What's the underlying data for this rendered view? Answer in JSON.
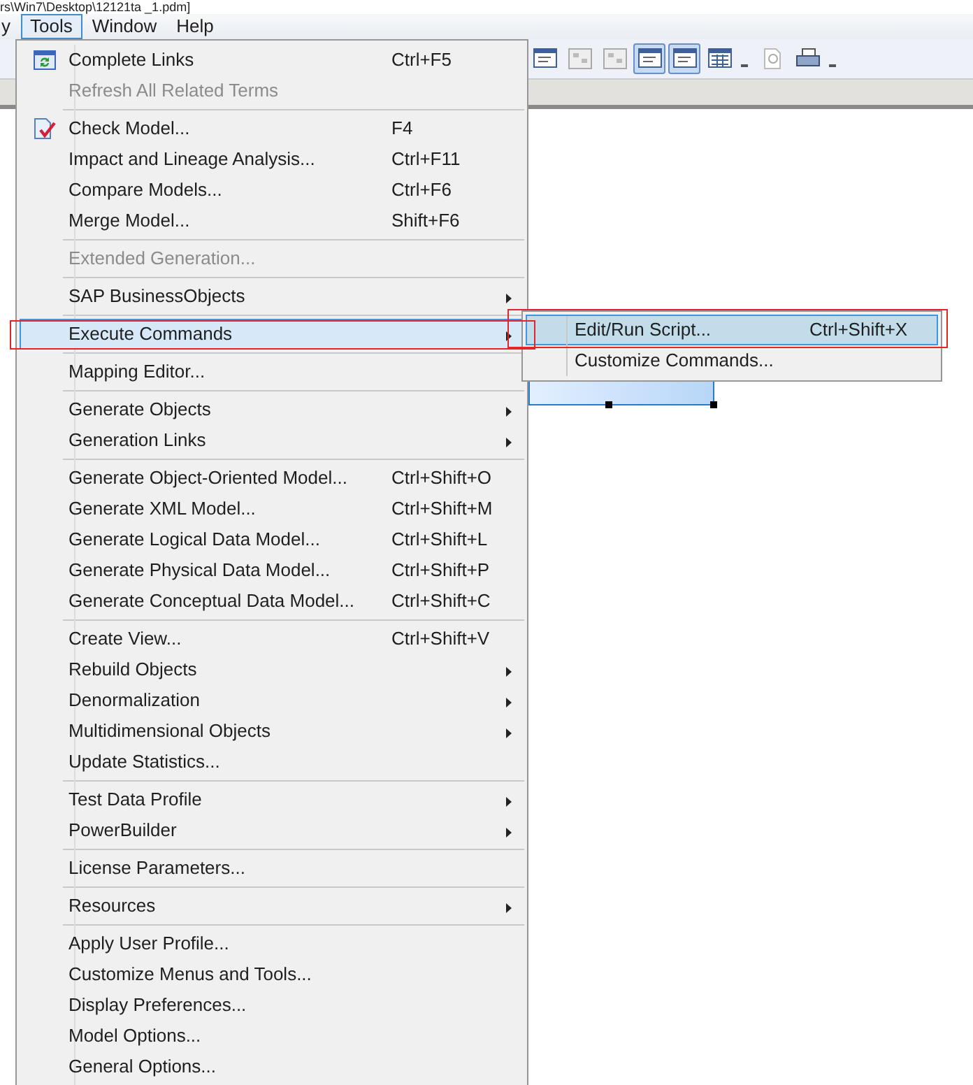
{
  "window": {
    "title": "rs\\Win7\\Desktop\\12121ta _1.pdm]"
  },
  "menu_bar": [
    {
      "label": "y",
      "selected": false
    },
    {
      "label": "Tools",
      "selected": true
    },
    {
      "label": "Window",
      "selected": false
    },
    {
      "label": "Help",
      "selected": false
    }
  ],
  "toolbar": [
    {
      "selected": false
    },
    {
      "selected": false
    },
    {
      "selected": false
    },
    {
      "selected": true
    },
    {
      "selected": true
    },
    {
      "selected": false
    },
    {
      "selected": false
    },
    {
      "selected": false
    }
  ],
  "tools_menu": [
    {
      "kind": "item",
      "label": "Complete Links",
      "shortcut": "Ctrl+F5",
      "disabled": false,
      "submenu": false,
      "selected": false
    },
    {
      "kind": "item",
      "label": "Refresh All Related Terms",
      "disabled": true,
      "submenu": false,
      "selected": false
    },
    {
      "kind": "separator"
    },
    {
      "kind": "item",
      "label": "Check Model...",
      "shortcut": "F4",
      "disabled": false,
      "submenu": false,
      "selected": false
    },
    {
      "kind": "item",
      "label": "Impact and Lineage Analysis...",
      "shortcut": "Ctrl+F11",
      "disabled": false,
      "submenu": false,
      "selected": false
    },
    {
      "kind": "item",
      "label": "Compare Models...",
      "shortcut": "Ctrl+F6",
      "disabled": false,
      "submenu": false,
      "selected": false
    },
    {
      "kind": "item",
      "label": "Merge Model...",
      "shortcut": "Shift+F6",
      "disabled": false,
      "submenu": false,
      "selected": false
    },
    {
      "kind": "separator"
    },
    {
      "kind": "item",
      "label": "Extended Generation...",
      "disabled": true,
      "submenu": false,
      "selected": false
    },
    {
      "kind": "separator"
    },
    {
      "kind": "item",
      "label": "SAP BusinessObjects",
      "disabled": false,
      "submenu": true,
      "selected": false
    },
    {
      "kind": "separator"
    },
    {
      "kind": "item",
      "label": "Execute Commands",
      "disabled": false,
      "submenu": true,
      "selected": true
    },
    {
      "kind": "separator"
    },
    {
      "kind": "item",
      "label": "Mapping Editor...",
      "disabled": false,
      "submenu": false,
      "selected": false
    },
    {
      "kind": "separator"
    },
    {
      "kind": "item",
      "label": "Generate Objects",
      "disabled": false,
      "submenu": true,
      "selected": false
    },
    {
      "kind": "item",
      "label": "Generation Links",
      "disabled": false,
      "submenu": true,
      "selected": false
    },
    {
      "kind": "separator"
    },
    {
      "kind": "item",
      "label": "Generate Object-Oriented Model...",
      "shortcut": "Ctrl+Shift+O",
      "disabled": false,
      "submenu": false,
      "selected": false
    },
    {
      "kind": "item",
      "label": "Generate XML Model...",
      "shortcut": "Ctrl+Shift+M",
      "disabled": false,
      "submenu": false,
      "selected": false
    },
    {
      "kind": "item",
      "label": "Generate Logical Data Model...",
      "shortcut": "Ctrl+Shift+L",
      "disabled": false,
      "submenu": false,
      "selected": false
    },
    {
      "kind": "item",
      "label": "Generate Physical Data Model...",
      "shortcut": "Ctrl+Shift+P",
      "disabled": false,
      "submenu": false,
      "selected": false
    },
    {
      "kind": "item",
      "label": "Generate Conceptual Data Model...",
      "shortcut": "Ctrl+Shift+C",
      "disabled": false,
      "submenu": false,
      "selected": false
    },
    {
      "kind": "separator"
    },
    {
      "kind": "item",
      "label": "Create View...",
      "shortcut": "Ctrl+Shift+V",
      "disabled": false,
      "submenu": false,
      "selected": false
    },
    {
      "kind": "item",
      "label": "Rebuild Objects",
      "disabled": false,
      "submenu": true,
      "selected": false
    },
    {
      "kind": "item",
      "label": "Denormalization",
      "disabled": false,
      "submenu": true,
      "selected": false
    },
    {
      "kind": "item",
      "label": "Multidimensional Objects",
      "disabled": false,
      "submenu": true,
      "selected": false
    },
    {
      "kind": "item",
      "label": "Update Statistics...",
      "disabled": false,
      "submenu": false,
      "selected": false
    },
    {
      "kind": "separator"
    },
    {
      "kind": "item",
      "label": "Test Data Profile",
      "disabled": false,
      "submenu": true,
      "selected": false
    },
    {
      "kind": "item",
      "label": "PowerBuilder",
      "disabled": false,
      "submenu": true,
      "selected": false
    },
    {
      "kind": "separator"
    },
    {
      "kind": "item",
      "label": "License Parameters...",
      "disabled": false,
      "submenu": false,
      "selected": false
    },
    {
      "kind": "separator"
    },
    {
      "kind": "item",
      "label": "Resources",
      "disabled": false,
      "submenu": true,
      "selected": false
    },
    {
      "kind": "separator"
    },
    {
      "kind": "item",
      "label": "Apply User Profile...",
      "disabled": false,
      "submenu": false,
      "selected": false
    },
    {
      "kind": "item",
      "label": "Customize Menus and Tools...",
      "disabled": false,
      "submenu": false,
      "selected": false
    },
    {
      "kind": "item",
      "label": "Display Preferences...",
      "disabled": false,
      "submenu": false,
      "selected": false
    },
    {
      "kind": "item",
      "label": "Model Options...",
      "disabled": false,
      "submenu": false,
      "selected": false
    },
    {
      "kind": "item",
      "label": "General Options...",
      "disabled": false,
      "submenu": false,
      "selected": false
    }
  ],
  "execute_commands_submenu": [
    {
      "label": "Edit/Run Script...",
      "shortcut": "Ctrl+Shift+X",
      "selected": true
    },
    {
      "label": "Customize Commands...",
      "selected": false
    }
  ]
}
